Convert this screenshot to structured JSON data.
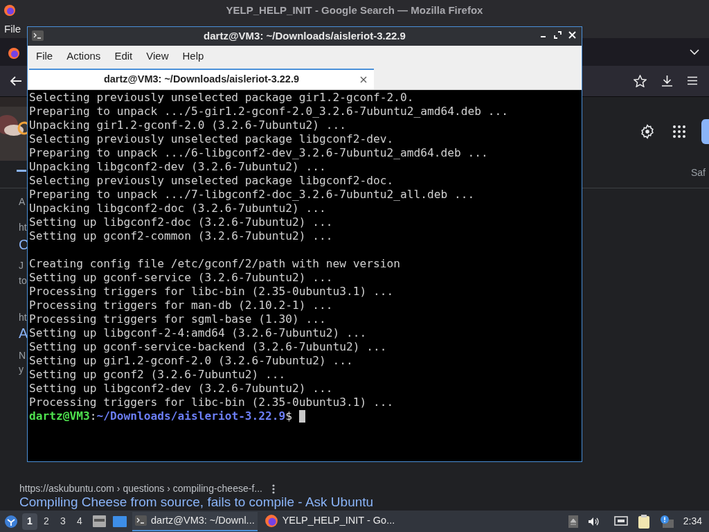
{
  "firefox": {
    "title": "YELP_HELP_INIT - Google Search — Mozilla Firefox",
    "menu": [
      "File"
    ],
    "page_fragments": [
      {
        "text": "A",
        "kind": "plain"
      },
      {
        "text": "ht",
        "kind": "plain"
      },
      {
        "text": "C",
        "kind": "link"
      },
      {
        "text": "J",
        "kind": "plain"
      },
      {
        "text": "to",
        "kind": "plain"
      },
      {
        "text": "ht",
        "kind": "plain"
      },
      {
        "text": "A",
        "kind": "link"
      },
      {
        "text": "N",
        "kind": "plain"
      },
      {
        "text": "y",
        "kind": "plain"
      }
    ],
    "tab_label_fragment": "Saf",
    "result": {
      "url": "https://askubuntu.com › questions › compiling-cheese-f...",
      "title": "Compiling Cheese from source, fails to compile - Ask Ubuntu"
    }
  },
  "terminal": {
    "title": "dartz@VM3: ~/Downloads/aisleriot-3.22.9",
    "menu": [
      "File",
      "Actions",
      "Edit",
      "View",
      "Help"
    ],
    "tabs": [
      {
        "label": "dartz@VM3: ~/Downloads/aisleriot-3.22.9",
        "selected": true
      }
    ],
    "lines": [
      "Selecting previously unselected package gir1.2-gconf-2.0.",
      "Preparing to unpack .../5-gir1.2-gconf-2.0_3.2.6-7ubuntu2_amd64.deb ...",
      "Unpacking gir1.2-gconf-2.0 (3.2.6-7ubuntu2) ...",
      "Selecting previously unselected package libgconf2-dev.",
      "Preparing to unpack .../6-libgconf2-dev_3.2.6-7ubuntu2_amd64.deb ...",
      "Unpacking libgconf2-dev (3.2.6-7ubuntu2) ...",
      "Selecting previously unselected package libgconf2-doc.",
      "Preparing to unpack .../7-libgconf2-doc_3.2.6-7ubuntu2_all.deb ...",
      "Unpacking libgconf2-doc (3.2.6-7ubuntu2) ...",
      "Setting up libgconf2-doc (3.2.6-7ubuntu2) ...",
      "Setting up gconf2-common (3.2.6-7ubuntu2) ...",
      {
        "kind": "blank"
      },
      "Creating config file /etc/gconf/2/path with new version",
      "Setting up gconf-service (3.2.6-7ubuntu2) ...",
      "Processing triggers for libc-bin (2.35-0ubuntu3.1) ...",
      "Processing triggers for man-db (2.10.2-1) ...",
      "Processing triggers for sgml-base (1.30) ...",
      "Setting up libgconf-2-4:amd64 (3.2.6-7ubuntu2) ...",
      "Setting up gconf-service-backend (3.2.6-7ubuntu2) ...",
      "Setting up gir1.2-gconf-2.0 (3.2.6-7ubuntu2) ...",
      "Setting up gconf2 (3.2.6-7ubuntu2) ...",
      "Setting up libgconf2-dev (3.2.6-7ubuntu2) ...",
      "Processing triggers for libc-bin (2.35-0ubuntu3.1) ..."
    ],
    "prompt": {
      "user_host": "dartz@VM3",
      "separator": ":",
      "path": "~/Downloads/aisleriot-3.22.9",
      "symbol": "$"
    }
  },
  "taskbar": {
    "workspaces": [
      {
        "label": "1",
        "selected": true
      },
      {
        "label": "2",
        "selected": false
      },
      {
        "label": "3",
        "selected": false
      },
      {
        "label": "4",
        "selected": false
      }
    ],
    "tasks": [
      {
        "kind": "terminal",
        "label": "dartz@VM3: ~/Downl...",
        "selected": true
      },
      {
        "kind": "firefox",
        "label": "YELP_HELP_INIT - Go...",
        "selected": false
      }
    ],
    "clock": "2:34"
  }
}
